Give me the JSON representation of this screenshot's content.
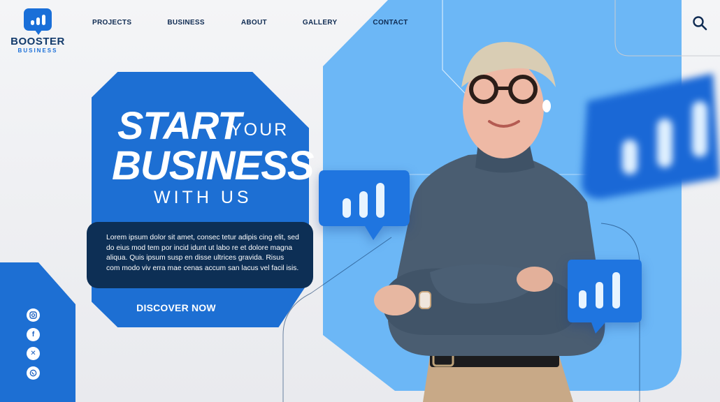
{
  "brand": {
    "name": "BOOSTER",
    "tagline": "BUSINESS"
  },
  "nav": [
    "PROJECTS",
    "BUSINESS",
    "ABOUT",
    "GALLERY",
    "CONTACT"
  ],
  "hero": {
    "title_start": "START",
    "title_your": "YOUR",
    "title_business": "BUSINESS",
    "title_with": "WITH US",
    "description": "Lorem ipsum dolor sit amet, consec tetur adipis cing elit, sed do eius mod tem por incid idunt ut labo re et dolore magna aliqua. Quis ipsum susp en disse ultrices gravida. Risus com modo viv erra mae cenas accum san lacus vel facil isis.",
    "cta_label": "DISCOVER NOW"
  },
  "social": [
    "instagram-icon",
    "facebook-icon",
    "x-icon",
    "whatsapp-icon"
  ],
  "colors": {
    "primary": "#1d6fd3",
    "dark": "#0d2f55",
    "light_blue": "#6cb7f6",
    "nav_text": "#0f2b52"
  }
}
